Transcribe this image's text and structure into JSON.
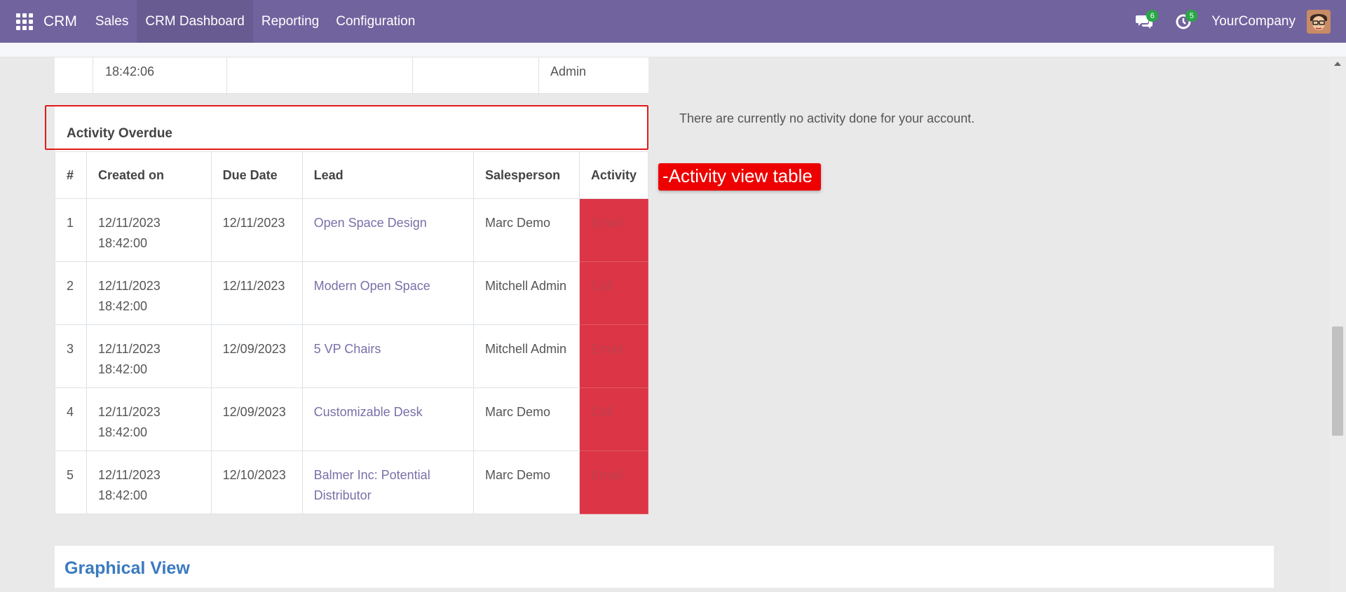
{
  "navbar": {
    "brand": "CRM",
    "menu": [
      "Sales",
      "CRM Dashboard",
      "Reporting",
      "Configuration"
    ],
    "active_menu": "CRM Dashboard",
    "messages_count": "6",
    "activities_count": "5",
    "company": "YourCompany",
    "color": "#71639e"
  },
  "previous_table": {
    "row_fragment": {
      "time": "18:42:06",
      "salesperson": "Admin"
    }
  },
  "activity_overdue": {
    "title": "Activity Overdue",
    "columns": [
      "#",
      "Created on",
      "Due Date",
      "Lead",
      "Salesperson",
      "Activity"
    ],
    "rows": [
      {
        "num": "1",
        "created_date": "12/11/2023",
        "created_time": "18:42:00",
        "due": "12/11/2023",
        "lead": "Open Space Design",
        "salesperson": "Marc Demo",
        "activity": "Email"
      },
      {
        "num": "2",
        "created_date": "12/11/2023",
        "created_time": "18:42:00",
        "due": "12/11/2023",
        "lead": "Modern Open Space",
        "salesperson": "Mitchell Admin",
        "activity": "Call"
      },
      {
        "num": "3",
        "created_date": "12/11/2023",
        "created_time": "18:42:00",
        "due": "12/09/2023",
        "lead": "5 VP Chairs",
        "salesperson": "Mitchell Admin",
        "activity": "Email"
      },
      {
        "num": "4",
        "created_date": "12/11/2023",
        "created_time": "18:42:00",
        "due": "12/09/2023",
        "lead": "Customizable Desk",
        "salesperson": "Marc Demo",
        "activity": "Call"
      },
      {
        "num": "5",
        "created_date": "12/11/2023",
        "created_time": "18:42:00",
        "due": "12/10/2023",
        "lead": "Balmer Inc: Potential Distributor",
        "salesperson": "Marc Demo",
        "activity": "Email"
      }
    ],
    "overdue_color": "#dc3545"
  },
  "activity_done_message": "There are currently no activity done for your account.",
  "annotation_label": "-Activity view table",
  "graphical_view_title": "Graphical View"
}
